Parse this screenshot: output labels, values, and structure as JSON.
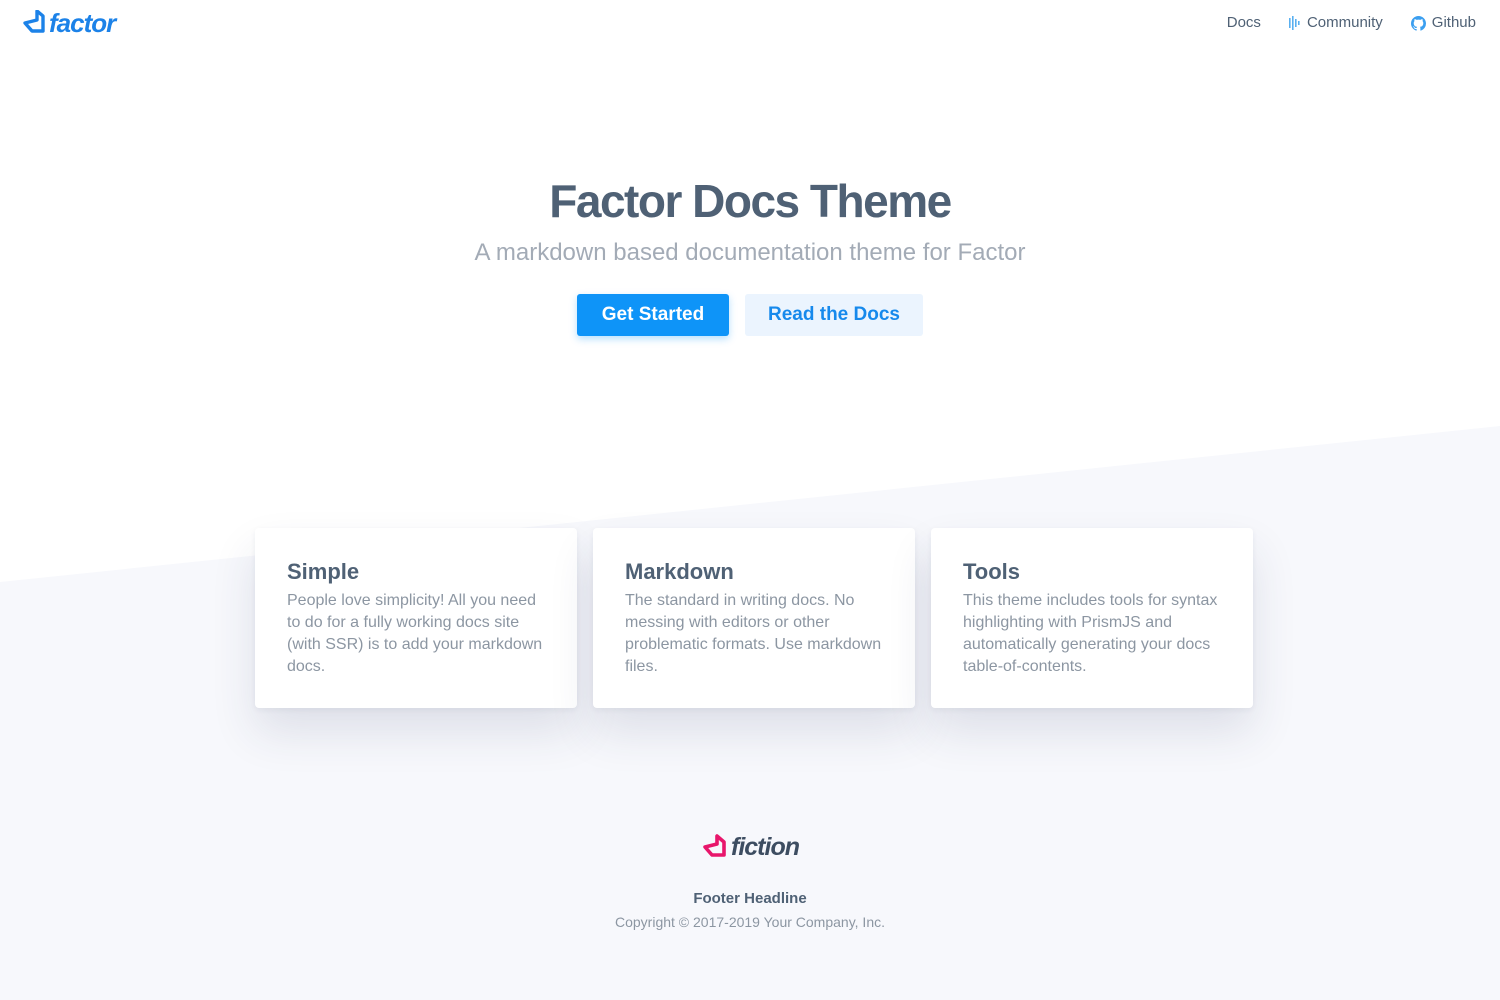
{
  "header": {
    "logo_text": "factor",
    "nav": [
      {
        "label": "Docs",
        "icon": ""
      },
      {
        "label": "Community",
        "icon": "community-icon"
      },
      {
        "label": "Github",
        "icon": "github-icon"
      }
    ]
  },
  "hero": {
    "title": "Factor Docs Theme",
    "subtitle": "A markdown based documentation theme for Factor",
    "primary_button": "Get Started",
    "secondary_button": "Read the Docs"
  },
  "features": [
    {
      "title": "Simple",
      "text": "People love simplicity! All you need to do for a fully working docs site (with SSR) is to add your markdown docs."
    },
    {
      "title": "Markdown",
      "text": "The standard in writing docs. No messing with editors or other problematic formats. Use markdown files."
    },
    {
      "title": "Tools",
      "text": "This theme includes tools for syntax highlighting with PrismJS and automatically generating your docs table-of-contents."
    }
  ],
  "footer": {
    "logo_text": "fiction",
    "headline": "Footer Headline",
    "copyright": "Copyright © 2017-2019 Your Company, Inc."
  },
  "colors": {
    "brand_blue": "#1c82e8",
    "primary_button": "#0e94f8",
    "fiction_pink": "#e8166b"
  }
}
